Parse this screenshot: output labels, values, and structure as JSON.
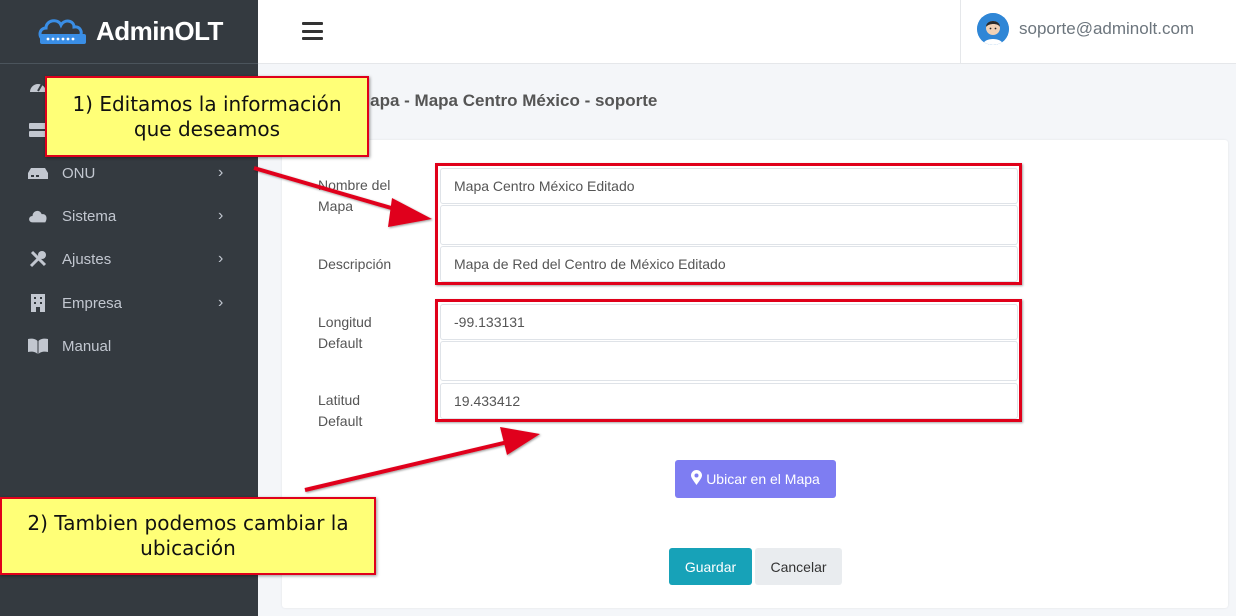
{
  "brand": {
    "name": "AdminOLT"
  },
  "sidebar": {
    "items": [
      {
        "label": "",
        "icon": "dashboard-icon"
      },
      {
        "label": "",
        "icon": "server-icon"
      },
      {
        "label": "ONU",
        "icon": "router-icon",
        "has_submenu": true
      },
      {
        "label": "Sistema",
        "icon": "cloud-icon",
        "has_submenu": true
      },
      {
        "label": "Ajustes",
        "icon": "tools-icon",
        "has_submenu": true
      },
      {
        "label": "Empresa",
        "icon": "building-icon",
        "has_submenu": true
      },
      {
        "label": "Manual",
        "icon": "book-icon",
        "has_submenu": false
      }
    ]
  },
  "header": {
    "menu_icon": "hamburger-icon",
    "user_email": "soporte@adminolt.com",
    "avatar": "user-avatar"
  },
  "page": {
    "title": "Mapa - Mapa Centro México - soporte"
  },
  "form": {
    "fields": [
      {
        "label": "Nombre del Mapa",
        "value": "Mapa Centro México Editado"
      },
      {
        "label": "Descripción",
        "value": "Mapa de Red del Centro de México Editado"
      },
      {
        "label": "Longitud Default",
        "value": "-99.133131"
      },
      {
        "label": "Latitud Default",
        "value": "19.433412"
      }
    ],
    "locate_button": "Ubicar en el Mapa",
    "save_button": "Guardar",
    "cancel_button": "Cancelar"
  },
  "annotations": {
    "note1_line1": "1) Editamos la información",
    "note1_line2": "que deseamos",
    "note2_line1": "2) Tambien podemos cambiar la",
    "note2_line2": "ubicación"
  },
  "colors": {
    "sidebar": "#343a40",
    "annotation_border": "#e0001a",
    "annotation_fill": "#ffff77",
    "locate_button": "#7e7df2",
    "save_button": "#17a2b8"
  }
}
